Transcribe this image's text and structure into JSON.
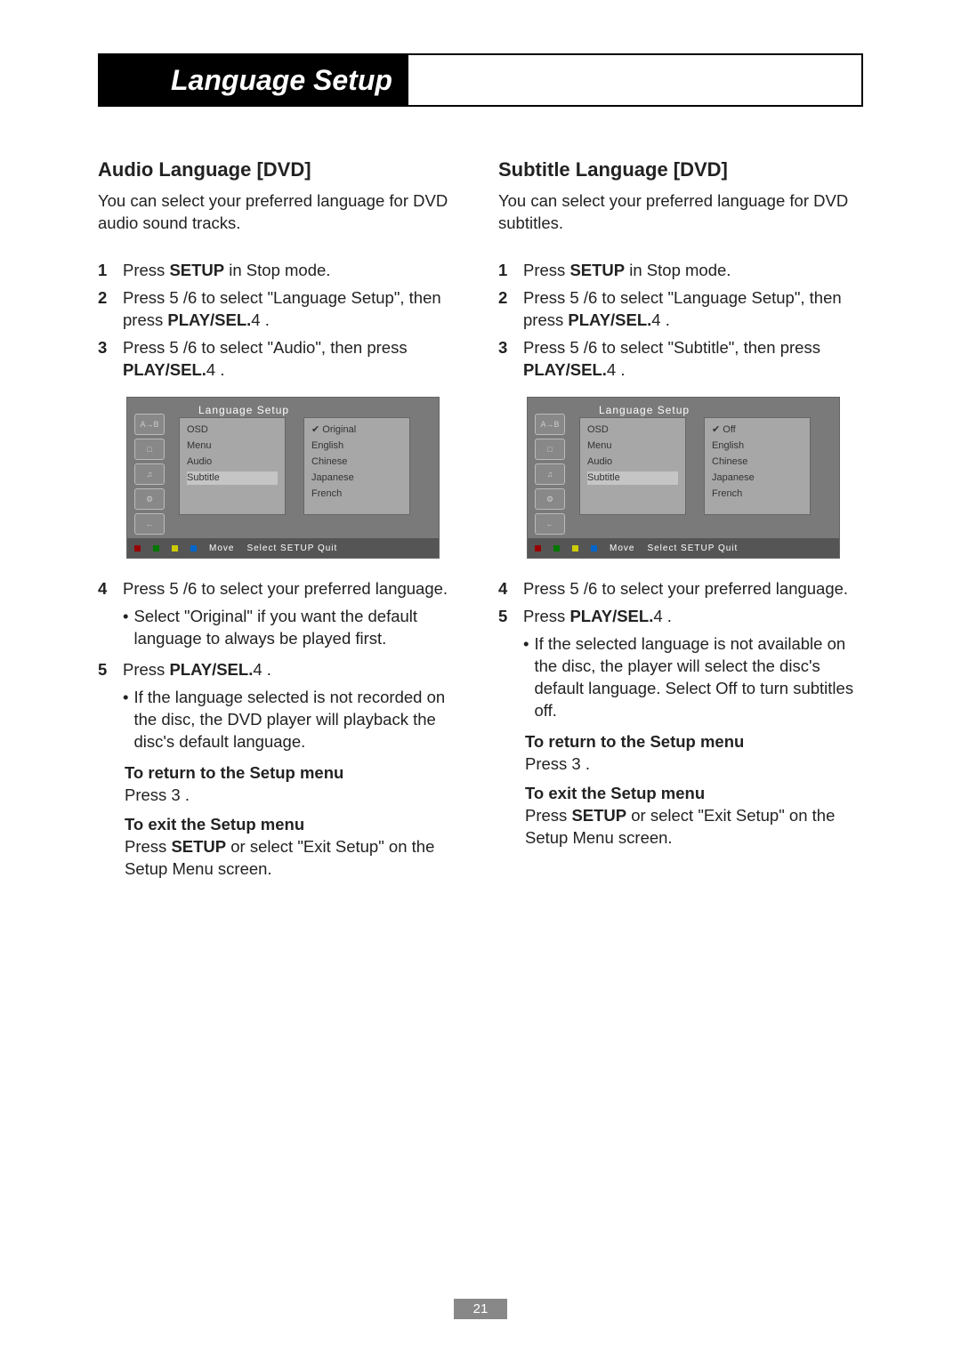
{
  "page_number": "21",
  "title": "Language Setup",
  "left": {
    "heading": "Audio Language [DVD]",
    "intro": "You can select your preferred language for DVD audio sound tracks.",
    "steps": [
      {
        "n": "1",
        "html": "Press <b>SETUP</b> in Stop mode."
      },
      {
        "n": "2",
        "html": "Press 5 /6 to select \"Language Setup\", then press <b>PLAY/SEL.</b>4 ."
      },
      {
        "n": "3",
        "html": "Press 5 /6 to select \"Audio\", then press <b>PLAY/SEL.</b>4 ."
      }
    ],
    "steps_after": [
      {
        "n": "4",
        "html": "Press 5 /6 to select your preferred language.",
        "sub": [
          "Select \"Original\" if you want the default language to always be played first."
        ]
      },
      {
        "n": "5",
        "html": "Press <b>PLAY/SEL.</b>4 .",
        "sub": [
          "If the language selected is not recorded on the disc, the DVD player will playback the disc's default language."
        ]
      }
    ],
    "return_title": "To return to the Setup menu",
    "return_body": "Press 3 .",
    "exit_title": "To exit the Setup menu",
    "exit_body": "Press <b>SETUP</b> or select \"Exit Setup\" on the Setup Menu screen.",
    "osd": {
      "header": "Language Setup",
      "panel1": [
        "OSD",
        "Menu",
        "Audio",
        "Subtitle"
      ],
      "panel2": [
        "Original",
        "English",
        "Chinese",
        "Japanese",
        "French"
      ],
      "footer_move": "Move",
      "footer_sel": "Select  SETUP  Quit"
    }
  },
  "right": {
    "heading": "Subtitle Language [DVD]",
    "intro": "You can select your preferred language for DVD subtitles.",
    "steps": [
      {
        "n": "1",
        "html": "Press <b>SETUP</b> in Stop mode."
      },
      {
        "n": "2",
        "html": "Press 5 /6 to select \"Language Setup\", then press <b>PLAY/SEL.</b>4 ."
      },
      {
        "n": "3",
        "html": "Press 5 /6 to select \"Subtitle\", then press <b>PLAY/SEL.</b>4 ."
      }
    ],
    "steps_after": [
      {
        "n": "4",
        "html": "Press 5 /6 to select your preferred language."
      },
      {
        "n": "5",
        "html": "Press <b>PLAY/SEL.</b>4 .",
        "sub": [
          "If the selected language is not available on the disc, the player will select the disc's default language. Select Off to turn subtitles off."
        ]
      }
    ],
    "return_title": "To return to the Setup menu",
    "return_body": "Press 3 .",
    "exit_title": "To exit the Setup menu",
    "exit_body": "Press <b>SETUP</b> or select \"Exit Setup\" on the Setup Menu screen.",
    "osd": {
      "header": "Language Setup",
      "panel1": [
        "OSD",
        "Menu",
        "Audio",
        "Subtitle"
      ],
      "panel2": [
        "Off",
        "English",
        "Chinese",
        "Japanese",
        "French"
      ],
      "footer_move": "Move",
      "footer_sel": "Select  SETUP  Quit"
    }
  }
}
